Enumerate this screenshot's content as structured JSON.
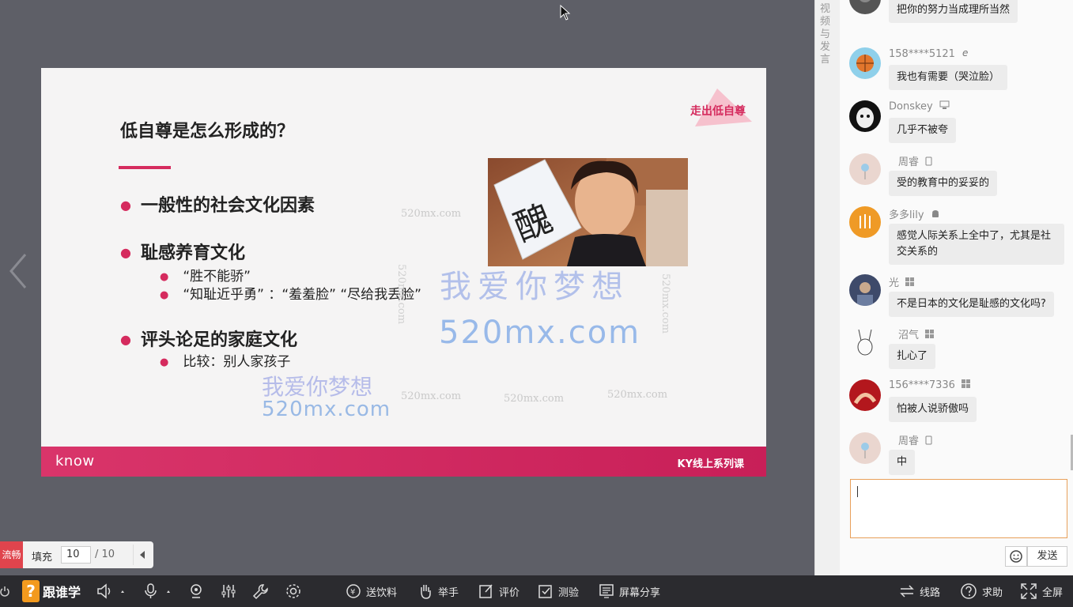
{
  "slide": {
    "title": "低自尊是怎么形成的？",
    "badge": "走出低自尊",
    "bullets": [
      {
        "text": "一般性的社会文化因素",
        "subs": []
      },
      {
        "text": "耻感养育文化",
        "subs": [
          "“胜不能骄”",
          "“知耻近乎勇”  ：“羞羞脸”  “尽给我丢脸”"
        ]
      },
      {
        "text": "评头论足的家庭文化",
        "subs": [
          "比较：别人家孩子"
        ]
      }
    ],
    "photo_glyph": "醜",
    "footer_logo": "know",
    "footer_course": "KY线上系列课",
    "colors": {
      "accent": "#d52b5e",
      "footer": "#cf2a60"
    }
  },
  "watermarks": {
    "small": "520mx.com",
    "big_cn": "我爱你梦想",
    "big_url": "520mx.com"
  },
  "page_control": {
    "smooth": "流畅",
    "fill": "填充",
    "current": "10",
    "total": "/ 10"
  },
  "side_tab": "视频与发言",
  "chat": {
    "messages": [
      {
        "name": "",
        "device": "",
        "text": "把你的努力当成理所当然"
      },
      {
        "name": "158****5121",
        "device": "ie-icon",
        "text": "我也有需要（哭泣脸）"
      },
      {
        "name": "Donskey",
        "device": "monitor-icon",
        "text": "几乎不被夸"
      },
      {
        "name": "周睿",
        "device": "phone-icon",
        "text": "受的教育中的妥妥的"
      },
      {
        "name": "多多lily",
        "device": "android-icon",
        "text": "感觉人际关系上全中了，尤其是社交关系的"
      },
      {
        "name": "光",
        "device": "windows-icon",
        "text": "不是日本的文化是耻感的文化吗?"
      },
      {
        "name": "沼气",
        "device": "windows-icon",
        "text": "扎心了"
      },
      {
        "name": "156****7336",
        "device": "windows-icon",
        "text": "怕被人说骄傲吗"
      },
      {
        "name": "周睿",
        "device": "phone-icon",
        "text": "中"
      }
    ],
    "input_value": "",
    "send_label": "发送"
  },
  "toolbar": {
    "logo_mark": "?",
    "logo_text": "跟谁学",
    "items": {
      "drink": "送饮料",
      "raise_hand": "举手",
      "rate": "评价",
      "quiz": "测验",
      "screen_share": "屏幕分享",
      "line": "线路",
      "help": "求助",
      "fullscreen": "全屏"
    }
  }
}
